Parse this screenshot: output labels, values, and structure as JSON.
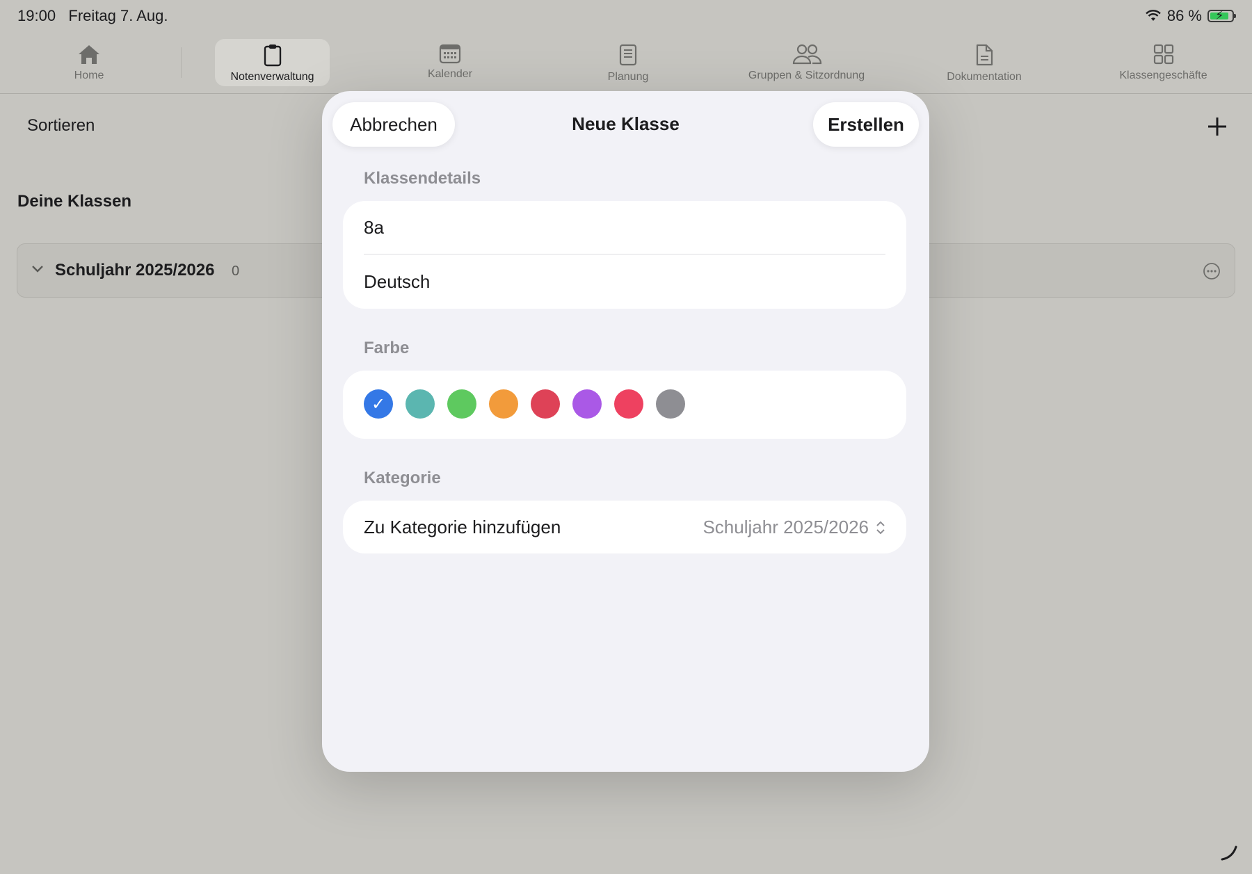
{
  "status": {
    "time": "19:00",
    "date": "Freitag 7. Aug.",
    "battery": "86 %",
    "battery_level": 0.86
  },
  "tabs": [
    {
      "label": "Home",
      "icon": "home-icon"
    },
    {
      "label": "Notenverwaltung",
      "icon": "clipboard-icon",
      "active": true
    },
    {
      "label": "Kalender",
      "icon": "calendar-icon"
    },
    {
      "label": "Planung",
      "icon": "document-stack-icon"
    },
    {
      "label": "Gruppen & Sitzordnung",
      "icon": "people-icon"
    },
    {
      "label": "Dokumentation",
      "icon": "doc-icon"
    },
    {
      "label": "Klassengeschäfte",
      "icon": "grid-icon"
    }
  ],
  "background": {
    "sort_label": "Sortieren",
    "section_title": "Deine Klassen",
    "category": {
      "title": "Schuljahr 2025/2026",
      "count": "0"
    }
  },
  "modal": {
    "cancel_label": "Abbrechen",
    "title": "Neue Klasse",
    "create_label": "Erstellen",
    "details_label": "Klassendetails",
    "class_name": "8a",
    "subject": "Deutsch",
    "color_label": "Farbe",
    "colors": [
      "#3478e6",
      "#5bb6b0",
      "#5ec95f",
      "#f29b3b",
      "#de4257",
      "#aa59e6",
      "#ee4160",
      "#8e8e93"
    ],
    "selected_color": 0,
    "category_label": "Kategorie",
    "category_row_label": "Zu Kategorie hinzufügen",
    "category_value": "Schuljahr 2025/2026"
  }
}
